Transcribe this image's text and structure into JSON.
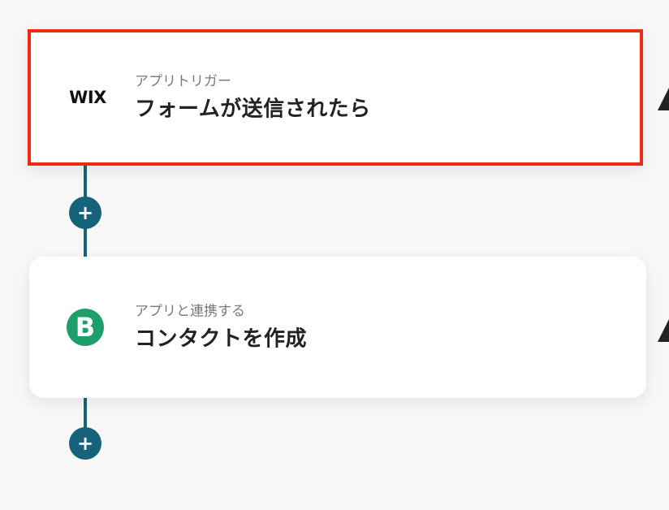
{
  "flow": {
    "trigger": {
      "logo_text": "WIX",
      "subtitle": "アプリトリガー",
      "title": "フォームが送信されたら",
      "highlight_color": "#ee2b12"
    },
    "action": {
      "logo_text": "B",
      "logo_color": "#1e9e6a",
      "subtitle": "アプリと連携する",
      "title": "コンタクトを作成"
    },
    "add_step_icon": "plus-icon",
    "connector_color": "#1b6279"
  }
}
